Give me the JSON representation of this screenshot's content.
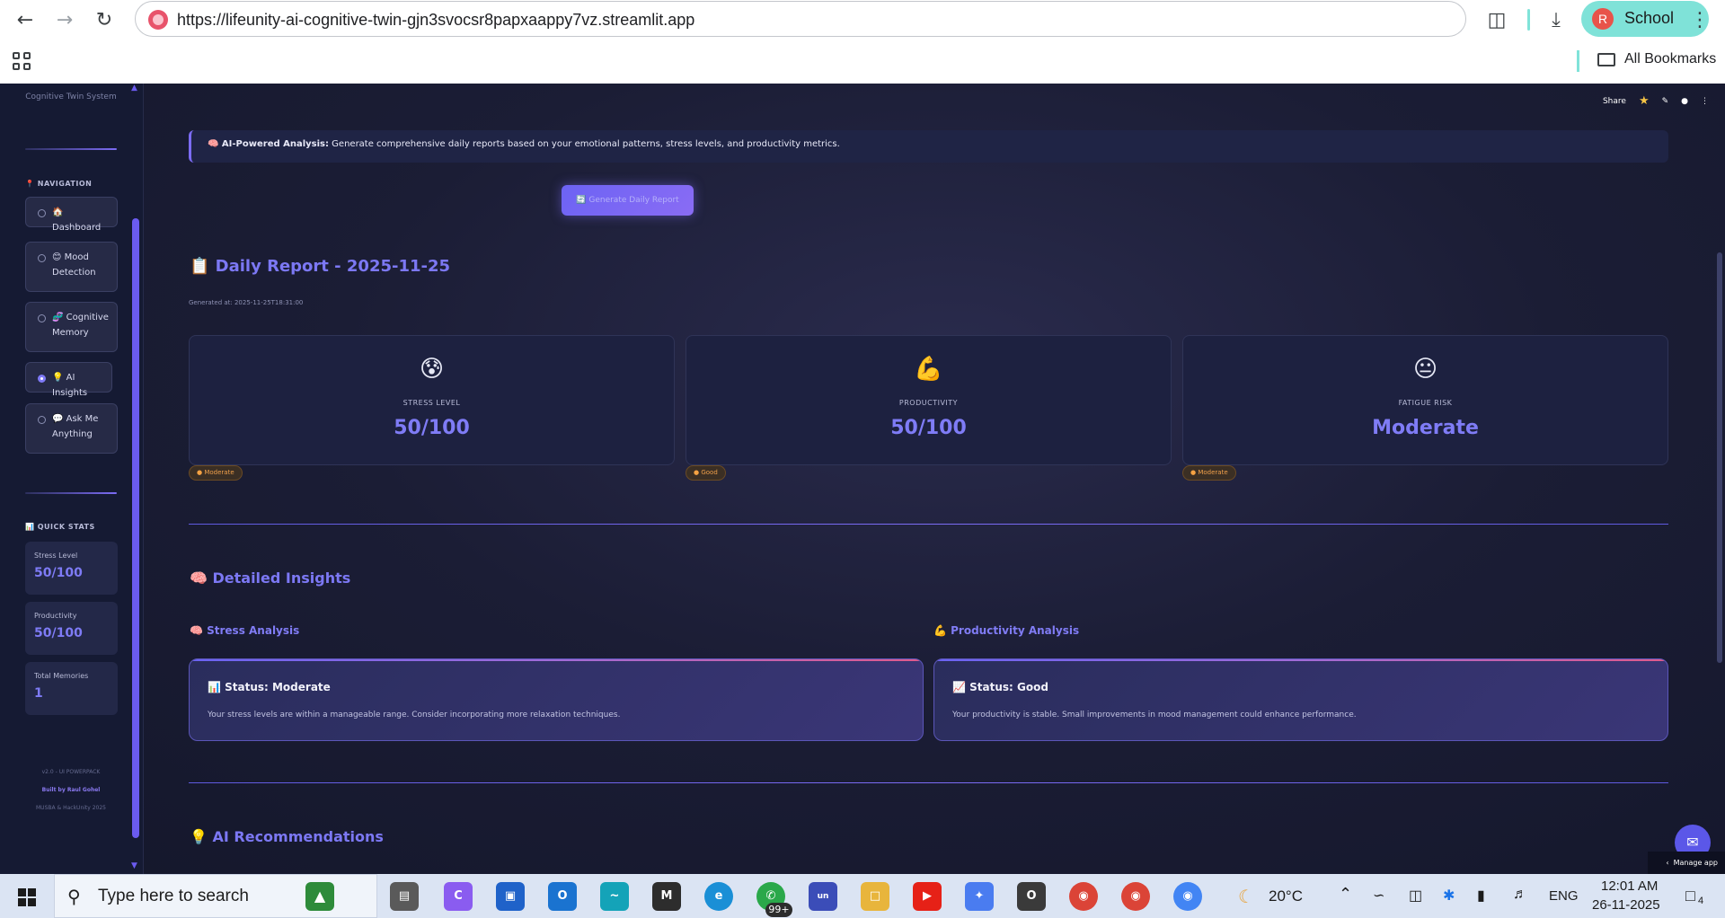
{
  "browser": {
    "url": "https://lifeunity-ai-cognitive-twin-gjn3svocsr8papxaappy7vz.streamlit.app",
    "profile_initial": "R",
    "profile_name": "School",
    "bookmarks_label": "All Bookmarks"
  },
  "sidebar": {
    "subtitle": "Cognitive Twin System",
    "nav_section": "📍 NAVIGATION",
    "items": [
      {
        "label": "🏠 Dashboard",
        "selected": false
      },
      {
        "label": "😊 Mood Detection",
        "selected": false
      },
      {
        "label": "🧬 Cognitive Memory",
        "selected": false
      },
      {
        "label": "💡 AI Insights",
        "selected": true
      },
      {
        "label": "💬 Ask Me Anything",
        "selected": false
      }
    ],
    "stats_section": "📊 QUICK STATS",
    "stats": [
      {
        "label": "Stress Level",
        "value": "50/100"
      },
      {
        "label": "Productivity",
        "value": "50/100"
      },
      {
        "label": "Total Memories",
        "value": "1"
      }
    ],
    "footer": {
      "version": "v2.0 - UI POWERPACK",
      "built_by": "Built by Raul Gohel",
      "event": "MUSBA & HackUnity 2025"
    }
  },
  "header": {
    "share": "Share",
    "star_icon": "star-icon",
    "edit_icon": "pencil-icon",
    "github_icon": "github-icon",
    "menu_icon": "kebab-menu-icon"
  },
  "main": {
    "banner_bold": "🧠 AI-Powered Analysis:",
    "banner_text": " Generate comprehensive daily reports based on your emotional patterns, stress levels, and productivity metrics.",
    "generate_button": "🔄 Generate Daily Report",
    "report_title": "📋 Daily Report - 2025-11-25",
    "generated_at": "Generated at: 2025-11-25T18:31:00",
    "metrics": [
      {
        "emoji": "😰",
        "label": "STRESS LEVEL",
        "value": "50/100",
        "badge": "Moderate"
      },
      {
        "emoji": "💪",
        "label": "PRODUCTIVITY",
        "value": "50/100",
        "badge": "Good"
      },
      {
        "emoji": "😐",
        "label": "FATIGUE RISK",
        "value": "Moderate",
        "badge": "Moderate"
      }
    ],
    "insights_title": "🧠 Detailed Insights",
    "stress_analysis": {
      "title": "🧠 Stress Analysis",
      "status": "📊 Status: Moderate",
      "desc": "Your stress levels are within a manageable range. Consider incorporating more relaxation techniques."
    },
    "productivity_analysis": {
      "title": "💪 Productivity Analysis",
      "status": "📈 Status: Good",
      "desc": "Your productivity is stable. Small improvements in mood management could enhance performance."
    },
    "recommendations_title": "💡 AI Recommendations",
    "manage_app": "Manage app"
  },
  "taskbar": {
    "search_placeholder": "Type here to search",
    "whatsapp_badge": "99+",
    "weather": "20°C",
    "language": "ENG",
    "time": "12:01 AM",
    "date": "26-11-2025",
    "notifications": "4"
  },
  "colors": {
    "accent": "#7c78f4",
    "background": "#1b1d35",
    "badge_text": "#f0a04b"
  }
}
